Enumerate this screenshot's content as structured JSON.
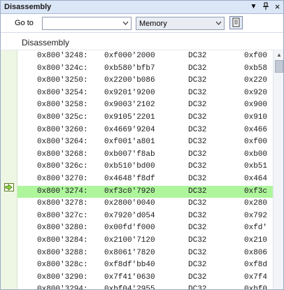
{
  "window": {
    "title": "Disassembly"
  },
  "title_buttons": {
    "dropdown": "▼",
    "pin": "ᵖ",
    "close": "×"
  },
  "toolbar": {
    "goto_label": "Go to",
    "goto_value": "",
    "memory_value": "Memory"
  },
  "section": {
    "heading": "Disassembly"
  },
  "current_row_index": 11,
  "rows": [
    {
      "addr": "0x800'3248:",
      "code": "0xf000'2000",
      "op": "DC32",
      "operand": "0xf00"
    },
    {
      "addr": "0x800'324c:",
      "code": "0xb580'bfb7",
      "op": "DC32",
      "operand": "0xb58"
    },
    {
      "addr": "0x800'3250:",
      "code": "0x2200'b086",
      "op": "DC32",
      "operand": "0x220"
    },
    {
      "addr": "0x800'3254:",
      "code": "0x9201'9200",
      "op": "DC32",
      "operand": "0x920"
    },
    {
      "addr": "0x800'3258:",
      "code": "0x9003'2102",
      "op": "DC32",
      "operand": "0x900"
    },
    {
      "addr": "0x800'325c:",
      "code": "0x9105'2201",
      "op": "DC32",
      "operand": "0x910"
    },
    {
      "addr": "0x800'3260:",
      "code": "0x4669'9204",
      "op": "DC32",
      "operand": "0x466"
    },
    {
      "addr": "0x800'3264:",
      "code": "0xf001'a801",
      "op": "DC32",
      "operand": "0xf00"
    },
    {
      "addr": "0x800'3268:",
      "code": "0xb007'f8ab",
      "op": "DC32",
      "operand": "0xb00"
    },
    {
      "addr": "0x800'326c:",
      "code": "0xb510'bd00",
      "op": "DC32",
      "operand": "0xb51"
    },
    {
      "addr": "0x800'3270:",
      "code": "0x4648'f8df",
      "op": "DC32",
      "operand": "0x464"
    },
    {
      "addr": "0x800'3274:",
      "code": "0xf3c0'7920",
      "op": "DC32",
      "operand": "0xf3c"
    },
    {
      "addr": "0x800'3278:",
      "code": "0x2800'0040",
      "op": "DC32",
      "operand": "0x280"
    },
    {
      "addr": "0x800'327c:",
      "code": "0x7920'd054",
      "op": "DC32",
      "operand": "0x792"
    },
    {
      "addr": "0x800'3280:",
      "code": "0x00fd'f000",
      "op": "DC32",
      "operand": "0xfd'"
    },
    {
      "addr": "0x800'3284:",
      "code": "0x2100'7120",
      "op": "DC32",
      "operand": "0x210"
    },
    {
      "addr": "0x800'3288:",
      "code": "0x8061'7820",
      "op": "DC32",
      "operand": "0x806"
    },
    {
      "addr": "0x800'328c:",
      "code": "0xf8df'bb40",
      "op": "DC32",
      "operand": "0xf8d"
    },
    {
      "addr": "0x800'3290:",
      "code": "0x7f41'0630",
      "op": "DC32",
      "operand": "0x7f4"
    },
    {
      "addr": "0x800'3294:",
      "code": "0xbf04'2955",
      "op": "DC32",
      "operand": "0xbf0"
    }
  ],
  "colors": {
    "current_row_bg": "#aef59c",
    "gutter_bg": "#eef6e4",
    "titlebar_bg": "#dbe6f6"
  }
}
